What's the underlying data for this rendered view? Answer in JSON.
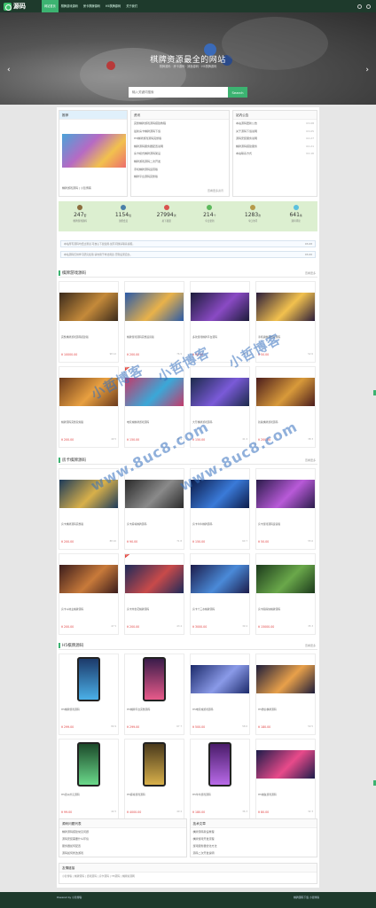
{
  "nav": {
    "logo_text": "源码",
    "items": [
      {
        "label": "网站首页",
        "active": true
      },
      {
        "label": "棋牌游戏源码",
        "active": false
      },
      {
        "label": "房卡棋牌源码",
        "active": false
      },
      {
        "label": "H5棋牌源码",
        "active": false
      },
      {
        "label": "关于我们",
        "active": false
      }
    ]
  },
  "banner": {
    "title": "棋牌资源最全的网站",
    "subtitle": "棋牌源码 · 房卡源码 · 捕鱼源码 · H5棋牌源码",
    "search_placeholder": "输入关键词搜索",
    "search_button": "Search",
    "prev": "‹",
    "next": "›"
  },
  "row1": {
    "featured": {
      "head": "推荐",
      "caption": "棋牌游戏源码 | 小哲博客"
    },
    "news": {
      "head": "资讯",
      "items": [
        "完整棋牌游戏源码搭建教程",
        "最新房卡棋牌源码下载",
        "H5棋牌游戏源码完整版",
        "棋牌源码服务器配置说明",
        "房卡模式棋牌源码架设",
        "棋牌游戏源码二次开发",
        "手机棋牌源码运营版",
        "棋牌平台源码完整版"
      ],
      "more": "查看更多资讯"
    },
    "notice": {
      "head": "站内公告",
      "items": [
        {
          "text": "本站源码更新公告",
          "date": "03-08"
        },
        {
          "text": "关于源码下载说明",
          "date": "03-05"
        },
        {
          "text": "源码安装服务说明",
          "date": "02-27"
        },
        {
          "text": "棋牌源码搭建服务",
          "date": "02-21"
        },
        {
          "text": "本站联系方式",
          "date": "02-16"
        }
      ]
    }
  },
  "stats": [
    {
      "value": "247",
      "unit": "套",
      "label": "棋牌游戏源码",
      "color": "#8c6d3e"
    },
    {
      "value": "1154",
      "unit": "位",
      "label": "注册会员",
      "color": "#4a7fa8"
    },
    {
      "value": "27994",
      "unit": "次",
      "label": "总下载量",
      "color": "#d9534f"
    },
    {
      "value": "214",
      "unit": "个",
      "label": "今日更新",
      "color": "#5cb85c"
    },
    {
      "value": "1283",
      "unit": "次",
      "label": "今日访问",
      "color": "#b59a4a"
    },
    {
      "value": "641",
      "unit": "条",
      "label": "源码评论",
      "color": "#5bc0de"
    }
  ],
  "notices": [
    {
      "text": "本站所有源码均经过测试,可放心下载使用,如有问题请联系客服。",
      "date": "03-08"
    },
    {
      "text": "本站源码仅供学习研究使用,请勿用于非法用途,否则后果自负。",
      "date": "03-06"
    }
  ],
  "sections": [
    {
      "title": "棋牌游戏源码",
      "more": "查看更多",
      "cards": [
        {
          "name": "完整棋牌游戏源码搭建版",
          "price": "¥ 10000.00",
          "meta": "98 12",
          "hot": false,
          "c1": "#3a2a1c",
          "c2": "#c48a3a"
        },
        {
          "name": "棋牌游戏源码完整运营版",
          "price": "¥ 200.00",
          "meta": "76 9",
          "hot": false,
          "c1": "#2a5aa8",
          "c2": "#e9b24a"
        },
        {
          "name": "多款游戏棋牌平台源码",
          "price": "¥ 90.00",
          "meta": "65 8",
          "hot": false,
          "c1": "#1c1c3a",
          "c2": "#8a4ac4"
        },
        {
          "name": "手机版棋牌游戏源码",
          "price": "¥ 50.00",
          "meta": "52 6",
          "hot": false,
          "c1": "#2a1c3a",
          "c2": "#f2c14e"
        },
        {
          "name": "棋牌源码完整双端版",
          "price": "¥ 200.00",
          "meta": "49 5",
          "hot": false,
          "c1": "#6a3a1c",
          "c2": "#e8a040"
        },
        {
          "name": "电玩城棋牌游戏源码",
          "price": "¥ 150.00",
          "meta": "45 4",
          "hot": true,
          "c1": "#c43a6a",
          "c2": "#3aa8d8"
        },
        {
          "name": "大厅棋牌游戏源码",
          "price": "¥ 150.00",
          "meta": "41 4",
          "hot": false,
          "c1": "#1c2a4a",
          "c2": "#7a5ad8"
        },
        {
          "name": "新版棋牌游戏源码",
          "price": "¥ 200.00",
          "meta": "38 3",
          "hot": false,
          "c1": "#4a1c1c",
          "c2": "#d89a3a"
        }
      ]
    },
    {
      "title": "房卡棋牌源码",
      "more": "查看更多",
      "cards": [
        {
          "name": "房卡棋牌源码完整版",
          "price": "¥ 200.00",
          "meta": "88 10",
          "hot": false,
          "c1": "#1c3a5a",
          "c2": "#d8b04a"
        },
        {
          "name": "房卡麻将棋牌源码",
          "price": "¥ 90.00",
          "meta": "71 8",
          "hot": false,
          "c1": "#2a2a2a",
          "c2": "#8a8a8a"
        },
        {
          "name": "房卡牛牛棋牌源码",
          "price": "¥ 150.00",
          "meta": "60 7",
          "hot": false,
          "c1": "#0c1c4a",
          "c2": "#3a7ad8"
        },
        {
          "name": "房卡游戏源码运营版",
          "price": "¥ 50.00",
          "meta": "55 6",
          "hot": false,
          "c1": "#2a1c4a",
          "c2": "#b85ad8"
        },
        {
          "name": "房卡斗地主棋牌源码",
          "price": "¥ 200.00",
          "meta": "47 5",
          "hot": false,
          "c1": "#3a1c1c",
          "c2": "#c87a3a"
        },
        {
          "name": "房卡炸金花棋牌源码",
          "price": "¥ 200.00",
          "meta": "43 4",
          "hot": true,
          "c1": "#1c2a5a",
          "c2": "#c84a4a"
        },
        {
          "name": "房卡十三水棋牌源码",
          "price": "¥ 3000.00",
          "meta": "39 4",
          "hot": false,
          "c1": "#1c1c4a",
          "c2": "#4a8ad8"
        },
        {
          "name": "房卡跑得快棋牌源码",
          "price": "¥ 15000.00",
          "meta": "35 3",
          "hot": false,
          "c1": "#1c3a1c",
          "c2": "#6aa84a"
        }
      ]
    },
    {
      "title": "H5棋牌源码",
      "more": "查看更多",
      "cards": [
        {
          "name": "H5棋牌游戏源码",
          "price": "¥ 299.00",
          "meta": "80 9",
          "hot": false,
          "c1": "#1c3a6a",
          "c2": "#4ab0e8",
          "phone": true
        },
        {
          "name": "H5棋牌平台完整源码",
          "price": "¥ 299.00",
          "meta": "67 7",
          "hot": false,
          "c1": "#3a1c4a",
          "c2": "#e85a8a",
          "phone": true
        },
        {
          "name": "H5电玩城游戏源码",
          "price": "¥ 500.00",
          "meta": "58 6",
          "hot": false,
          "c1": "#1c2a6a",
          "c2": "#8a9ae8",
          "phone": false
        },
        {
          "name": "H5微信棋牌源码",
          "price": "¥ 180.00",
          "meta": "50 5",
          "hot": false,
          "c1": "#1c1c3a",
          "c2": "#e8a04a",
          "phone": false
        },
        {
          "name": "H5德州扑克源码",
          "price": "¥ 99.00",
          "meta": "44 5",
          "hot": false,
          "c1": "#1c4a2a",
          "c2": "#6ad88a",
          "phone": true
        },
        {
          "name": "H5麻将游戏源码",
          "price": "¥ 4000.00",
          "meta": "40 4",
          "hot": false,
          "c1": "#4a3a1c",
          "c2": "#d8b04a",
          "phone": true
        },
        {
          "name": "H5牛牛游戏源码",
          "price": "¥ 180.00",
          "meta": "36 3",
          "hot": false,
          "c1": "#4a1c6a",
          "c2": "#b86ae8",
          "phone": true
        },
        {
          "name": "H5捕鱼游戏源码",
          "price": "¥ 80.00",
          "meta": "32 3",
          "hot": false,
          "c1": "#1c1c4a",
          "c2": "#e84a8a",
          "phone": false
        }
      ]
    }
  ],
  "bottom": {
    "left": {
      "head": "源码问题列表",
      "items": [
        "棋牌源码搭建常见问题",
        "源码安装需要什么环境",
        "服务器如何配置",
        "源码如何修改游戏"
      ]
    },
    "right": {
      "head": "技术文章",
      "items": [
        "棋牌源码架设教程",
        "棋牌游戏开发流程",
        "游戏服务器优化方法",
        "源码二次开发说明"
      ]
    }
  },
  "links": {
    "head": "友情链接",
    "items": "小哲博客 | 棋牌源码 | 游戏源码 | 房卡源码 | H5源码 | 棋牌资源网"
  },
  "watermark": {
    "name": "小哲博客",
    "url": "www.8uc8.com"
  },
  "footer": {
    "left": "Powered by 小哲博客",
    "right": "棋牌源码下载 小哲博客"
  }
}
